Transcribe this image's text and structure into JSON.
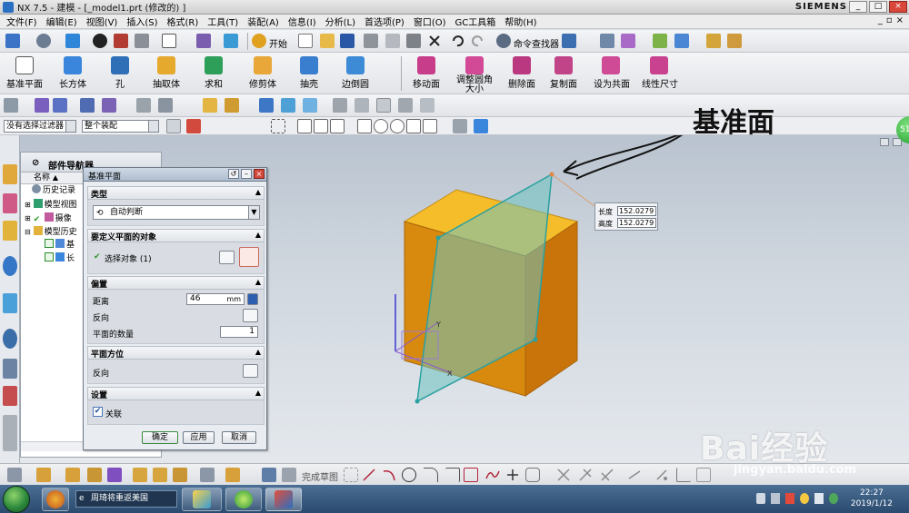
{
  "window": {
    "title": "NX 7.5 - 建模 - [_model1.prt  (修改的) ]",
    "brand": "SIEMENS",
    "buttons": [
      "_",
      "□",
      "×"
    ]
  },
  "menu": {
    "items": [
      "文件(F)",
      "编辑(E)",
      "视图(V)",
      "插入(S)",
      "格式(R)",
      "工具(T)",
      "装配(A)",
      "信息(I)",
      "分析(L)",
      "首选项(P)",
      "窗口(O)",
      "GC工具箱",
      "帮助(H)"
    ]
  },
  "toolbar1": {
    "start_label": "开始",
    "command_finder_label": "命令查找器"
  },
  "toolbar2": {
    "tools": [
      "基准平面",
      "长方体",
      "孔",
      "抽取体",
      "求和",
      "修剪体",
      "抽壳",
      "边倒圆",
      "移动面",
      "调整圆角大小",
      "删除面",
      "复制面",
      "设为共面",
      "线性尺寸"
    ]
  },
  "filters": {
    "selection_filter": "没有选择过滤器",
    "assembly_scope": "整个装配"
  },
  "navigator": {
    "title": "部件导航器",
    "column": "名称",
    "rows": [
      "历史记录",
      "模型视图",
      "摄像",
      "模型历史",
      "基",
      "长"
    ]
  },
  "dialog": {
    "title": "基准平面",
    "sections": {
      "type": "类型",
      "object": "要定义平面的对象",
      "offset": "偏置",
      "orientation": "平面方位",
      "settings": "设置"
    },
    "type_value": "自动判断",
    "select_object": "选择对象 (1)",
    "distance_label": "距离",
    "distance_value": "46",
    "distance_unit": "mm",
    "reverse_label": "反向",
    "plane_count_label": "平面的数量",
    "plane_count_value": "1",
    "orientation_reverse": "反向",
    "associative_label": "关联",
    "ok": "确定",
    "apply": "应用",
    "cancel": "取消"
  },
  "viewport": {
    "annotation": "基准面",
    "length_label": "长度",
    "length_value": "152.0279",
    "height_label": "高度",
    "height_value": "152.0279",
    "axis_labels": [
      "Y",
      "X"
    ]
  },
  "bottombar": {
    "sketch_label": "完成草图"
  },
  "taskbar": {
    "search_text": "周琦将重返美国",
    "time": "22:27",
    "date": "2019/1/12"
  },
  "watermark": {
    "main": "Bai经验",
    "url": "jingyan.baidu.com"
  },
  "badge": "51",
  "colors": {
    "cube_front": "#d88a0f",
    "cube_top": "#f5bd2a",
    "cube_side": "#c9730b",
    "plane": "#6ec3c0"
  }
}
